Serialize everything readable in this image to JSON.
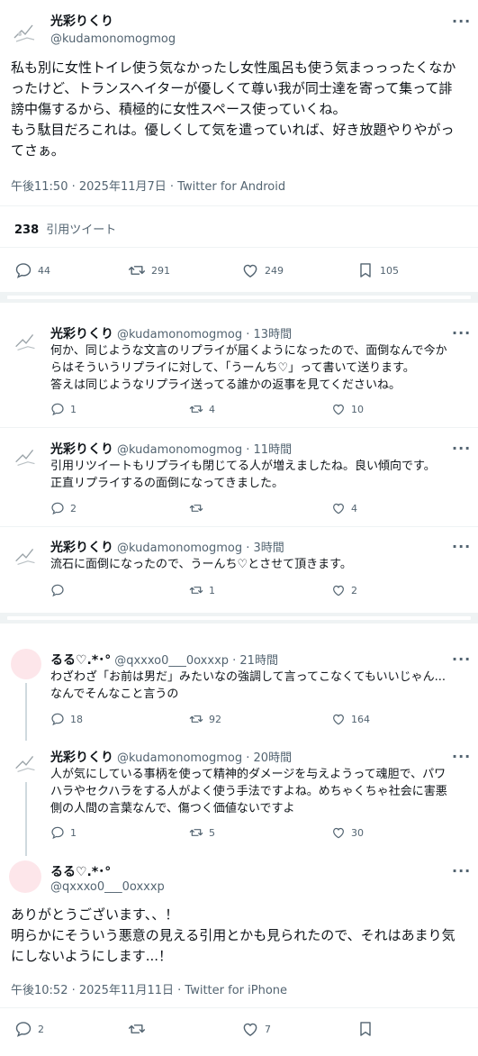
{
  "main_post": {
    "name": "光彩りくり",
    "handle": "@kudamonomogmog",
    "text_lines": [
      "私も別に女性トイレ使う気なかったし女性風呂も使う気まっっったくなか",
      "ったけど、トランスヘイターが優しくて尊い我が同士達を寄って集って誹",
      "謗中傷するから、積極的に女性スペース使っていくね。",
      "もう駄目だろこれは。優しくして気を遣っていれば、好き放題やりやがっ",
      "てさぁ。"
    ],
    "timestamp": "午後11:50 · 2025年11月7日 · Twitter for Android",
    "quote_count": "238",
    "quote_label": "引用ツイート",
    "replies": "44",
    "retweets": "291",
    "likes": "249",
    "bookmarks": "105"
  },
  "self_replies": [
    {
      "name": "光彩りくり",
      "handle_time": "@kudamonomogmog · 13時間",
      "lines": [
        "何か、同じような文言のリプライが届くようになったので、面倒なんで今か",
        "らはそういうリプライに対して、「うーんち♡」って書いて送ります。",
        "答えは同じようなリプライ送ってる誰かの返事を見てくださいね。"
      ],
      "replies": "1",
      "retweets": "4",
      "likes": "10"
    },
    {
      "name": "光彩りくり",
      "handle_time": "@kudamonomogmog · 11時間",
      "lines": [
        "引用リツイートもリプライも閉じてる人が増えましたね。良い傾向です。",
        "正直リプライするの面倒になってきました。"
      ],
      "replies": "2",
      "retweets": "",
      "likes": "4"
    },
    {
      "name": "光彩りくり",
      "handle_time": "@kudamonomogmog · 3時間",
      "lines": [
        "流石に面倒になったので、うーんち♡とさせて頂きます。"
      ],
      "replies": "",
      "retweets": "1",
      "likes": "2"
    }
  ],
  "thread": [
    {
      "name": "るる♡.*･°",
      "handle_time": "@qxxxo0___0oxxxp · 21時間",
      "lines": [
        "わざわざ「お前は男だ」みたいなの強調して言ってこなくてもいいじゃん...",
        "なんでそんなこと言うの"
      ],
      "replies": "18",
      "retweets": "92",
      "likes": "164"
    },
    {
      "name": "光彩りくり",
      "handle_time": "@kudamonomogmog · 20時間",
      "lines": [
        "人が気にしている事柄を使って精神的ダメージを与えようって魂胆で、パワ",
        "ハラやセクハラをする人がよく使う手法ですよね。めちゃくちゃ社会に害悪",
        "側の人間の言葉なんで、傷つく価値ないですよ"
      ],
      "replies": "1",
      "retweets": "5",
      "likes": "30"
    }
  ],
  "final_post": {
    "name": "るる♡.*･°",
    "handle": "@qxxxo0___0oxxxp",
    "text_lines": [
      "ありがとうございます、、！",
      "明らかにそういう悪意の見える引用とかも見られたので、それはあまり気",
      "にしないようにします...！"
    ],
    "timestamp": "午後10:52 · 2025年11月11日 · Twitter for iPhone",
    "replies": "2",
    "retweets": "",
    "likes": "7"
  }
}
